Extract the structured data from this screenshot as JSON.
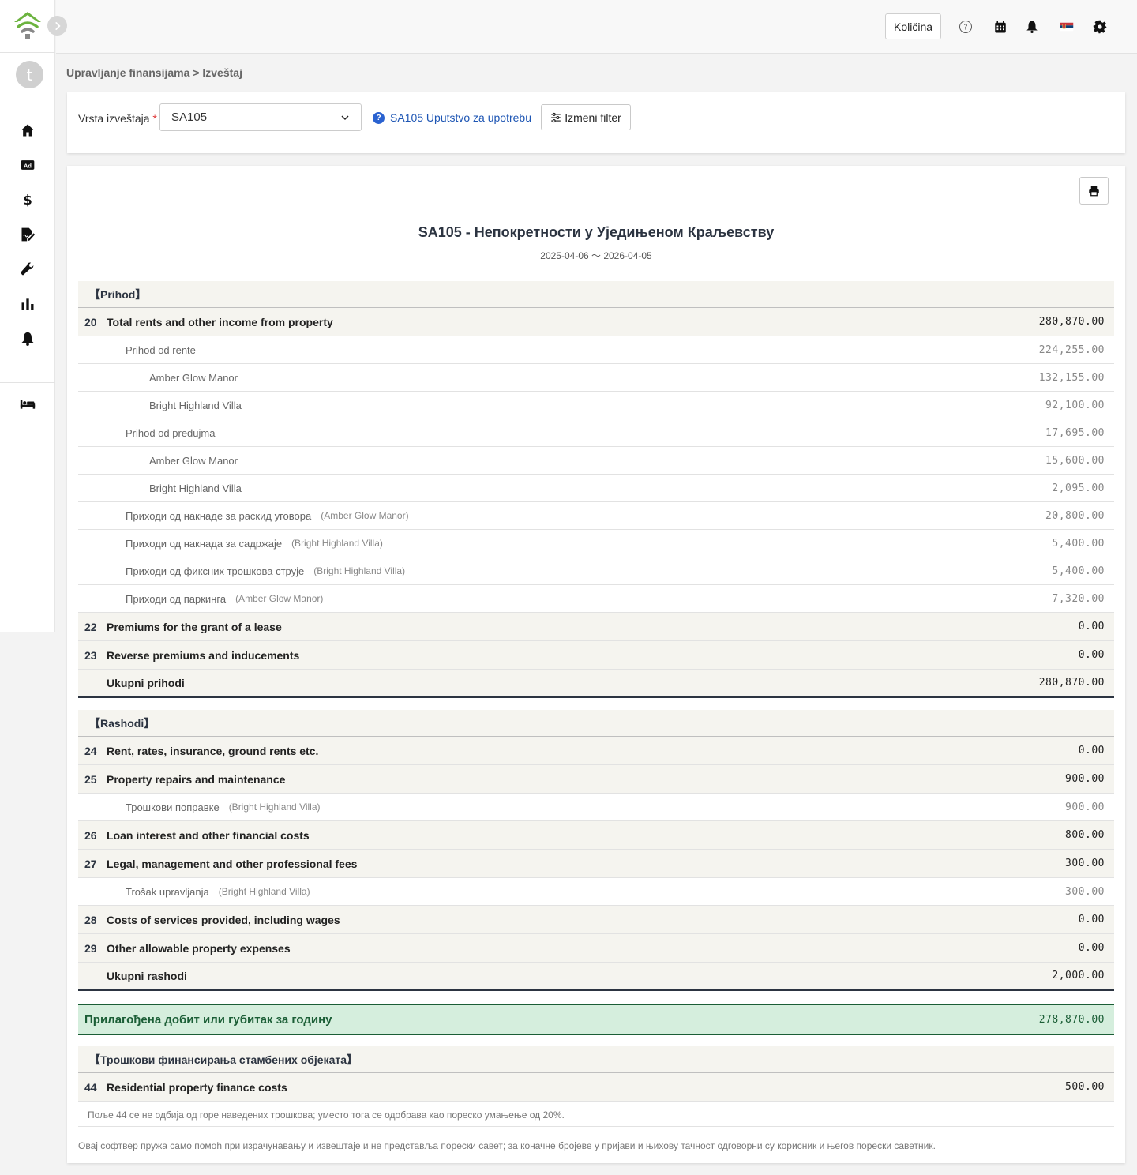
{
  "sidebar": {
    "avatar_letter": "t",
    "icons": [
      "home-icon",
      "ad-icon",
      "dollar-icon",
      "contract-icon",
      "wrench-icon",
      "bar-chart-icon",
      "bell-icon",
      "bed-icon"
    ]
  },
  "topbar": {
    "quantity_label": "Količina"
  },
  "breadcrumb": {
    "parent": "Upravljanje finansijama",
    "separator": ">",
    "current": "Izveštaj"
  },
  "filter": {
    "label": "Vrsta izveštaja",
    "required_mark": "*",
    "selected": "SA105",
    "guide_link": "SA105 Uputstvo za upotrebu",
    "edit_filter_label": "Izmeni filter"
  },
  "report": {
    "title": "SA105 - Непокретности у Уједињеном Краљевству",
    "period": "2025-04-06 〜 2026-04-05",
    "income_header": "【Prihod】",
    "income_rows": [
      {
        "type": "main",
        "num": "20",
        "label": "Total rents and other income from property",
        "prop": "",
        "value": "280,870.00"
      },
      {
        "type": "sub1",
        "num": "",
        "label": "Prihod od rente",
        "prop": "",
        "value": "224,255.00"
      },
      {
        "type": "sub2",
        "num": "",
        "label": "Amber Glow Manor",
        "prop": "",
        "value": "132,155.00"
      },
      {
        "type": "sub2",
        "num": "",
        "label": "Bright Highland Villa",
        "prop": "",
        "value": "92,100.00"
      },
      {
        "type": "sub1",
        "num": "",
        "label": "Prihod od predujma",
        "prop": "",
        "value": "17,695.00"
      },
      {
        "type": "sub2",
        "num": "",
        "label": "Amber Glow Manor",
        "prop": "",
        "value": "15,600.00"
      },
      {
        "type": "sub2",
        "num": "",
        "label": "Bright Highland Villa",
        "prop": "",
        "value": "2,095.00"
      },
      {
        "type": "sub1",
        "num": "",
        "label": "Приходи од накнаде за раскид уговора",
        "prop": "(Amber Glow Manor)",
        "value": "20,800.00"
      },
      {
        "type": "sub1",
        "num": "",
        "label": "Приходи од накнада за садржаје",
        "prop": "(Bright Highland Villa)",
        "value": "5,400.00"
      },
      {
        "type": "sub1",
        "num": "",
        "label": "Приходи од фиксних трошкова струје",
        "prop": "(Bright Highland Villa)",
        "value": "5,400.00"
      },
      {
        "type": "sub1",
        "num": "",
        "label": "Приходи од паркинга",
        "prop": "(Amber Glow Manor)",
        "value": "7,320.00"
      },
      {
        "type": "main",
        "num": "22",
        "label": "Premiums for the grant of a lease",
        "prop": "",
        "value": "0.00"
      },
      {
        "type": "main",
        "num": "23",
        "label": "Reverse premiums and inducements",
        "prop": "",
        "value": "0.00"
      },
      {
        "type": "total",
        "num": "",
        "label": "Ukupni prihodi",
        "prop": "",
        "value": "280,870.00"
      }
    ],
    "expense_header": "【Rashodi】",
    "expense_rows": [
      {
        "type": "main",
        "num": "24",
        "label": "Rent, rates, insurance, ground rents etc.",
        "prop": "",
        "value": "0.00"
      },
      {
        "type": "main",
        "num": "25",
        "label": "Property repairs and maintenance",
        "prop": "",
        "value": "900.00"
      },
      {
        "type": "sub1",
        "num": "",
        "label": "Трошкови поправке",
        "prop": "(Bright Highland Villa)",
        "value": "900.00"
      },
      {
        "type": "main",
        "num": "26",
        "label": "Loan interest and other financial costs",
        "prop": "",
        "value": "800.00"
      },
      {
        "type": "main",
        "num": "27",
        "label": "Legal, management and other professional fees",
        "prop": "",
        "value": "300.00"
      },
      {
        "type": "sub1",
        "num": "",
        "label": "Trošak upravljanja",
        "prop": "(Bright Highland Villa)",
        "value": "300.00"
      },
      {
        "type": "main",
        "num": "28",
        "label": "Costs of services provided, including wages",
        "prop": "",
        "value": "0.00"
      },
      {
        "type": "main",
        "num": "29",
        "label": "Other allowable property expenses",
        "prop": "",
        "value": "0.00"
      },
      {
        "type": "total",
        "num": "",
        "label": "Ukupni rashodi",
        "prop": "",
        "value": "2,000.00"
      }
    ],
    "net": {
      "label": "Прилагођена добит или губитак за годину",
      "value": "278,870.00"
    },
    "finance_header": "【Трошкови финансирања стамбених објеката】",
    "finance_rows": [
      {
        "type": "main",
        "num": "44",
        "label": "Residential property finance costs",
        "prop": "",
        "value": "500.00"
      }
    ],
    "finance_note": "Поље 44 се не одбија од горе наведених трошкова; уместо тога се одобрава као пореско умањење од 20%.",
    "disclaimer": "Овај софтвер пружа само помоћ при израчунавању и извештаје и не представља порески савет; за коначне бројеве у пријави и њихову тачност одговорни су корисник и његов порески саветник."
  }
}
